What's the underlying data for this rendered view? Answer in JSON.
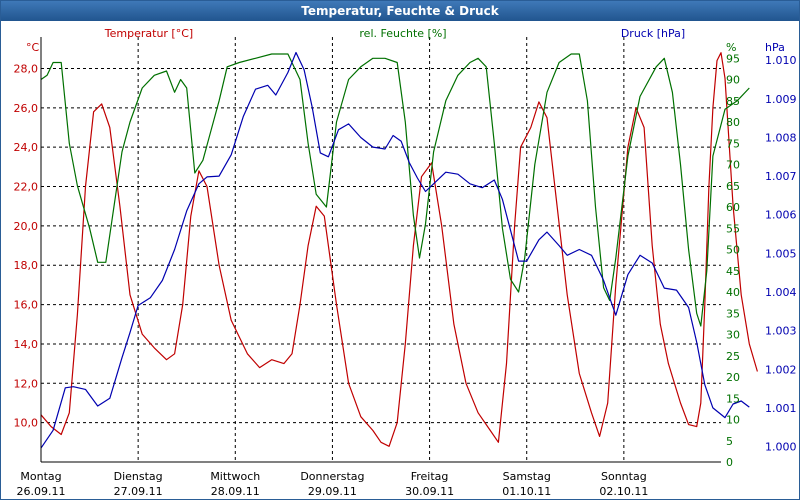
{
  "window": {
    "title": "Temperatur, Feuchte & Druck"
  },
  "colors": {
    "temperature": "#c00000",
    "humidity": "#007000",
    "pressure": "#0000b0",
    "grid": "#000000",
    "frame": "#2a5d96"
  },
  "chart_data": {
    "type": "line",
    "title": "Temperatur, Feuchte & Druck",
    "x_start": "26.09.11 00:00",
    "x_end": "03.10.11 00:00",
    "x_categories": [
      {
        "day": "Montag",
        "date": "26.09.11"
      },
      {
        "day": "Dienstag",
        "date": "27.09.11"
      },
      {
        "day": "Mittwoch",
        "date": "28.09.11"
      },
      {
        "day": "Donnerstag",
        "date": "29.09.11"
      },
      {
        "day": "Freitag",
        "date": "30.09.11"
      },
      {
        "day": "Samstag",
        "date": "01.10.11"
      },
      {
        "day": "Sonntag",
        "date": "02.10.11"
      }
    ],
    "axes": {
      "left": {
        "label": "Temperatur [°C]",
        "unit": "°C",
        "min": 8,
        "max": 29.6,
        "ticks": [
          10.0,
          12.0,
          14.0,
          16.0,
          18.0,
          20.0,
          22.0,
          24.0,
          26.0,
          28.0
        ],
        "tick_labels": [
          "10,0",
          "12,0",
          "14,0",
          "16,0",
          "18,0",
          "20,0",
          "22,0",
          "24,0",
          "26,0",
          "28,0"
        ]
      },
      "middle": {
        "label": "rel. Feuchte [%]",
        "unit": "%",
        "min": 0,
        "max": 100,
        "ticks": [
          0,
          5,
          10,
          15,
          20,
          25,
          30,
          35,
          40,
          45,
          50,
          55,
          60,
          65,
          70,
          75,
          80,
          85,
          90,
          95
        ],
        "tick_labels": [
          "0",
          "5",
          "10",
          "15",
          "20",
          "25",
          "30",
          "35",
          "40",
          "45",
          "50",
          "55",
          "60",
          "65",
          "70",
          "75",
          "80",
          "85",
          "90",
          "95"
        ]
      },
      "right": {
        "label": "Druck [hPa]",
        "unit": "hPa",
        "min": 0.9996,
        "max": 1.0106,
        "ticks": [
          1.0,
          1.001,
          1.002,
          1.003,
          1.004,
          1.005,
          1.006,
          1.007,
          1.008,
          1.009,
          1.01
        ],
        "tick_labels": [
          "1.000",
          "1.001",
          "1.002",
          "1.003",
          "1.004",
          "1.005",
          "1.006",
          "1.007",
          "1.008",
          "1.009",
          "1.010"
        ]
      }
    },
    "grid": true,
    "series": [
      {
        "name": "Temperatur [°C]",
        "axis": "left",
        "color": "#c00000",
        "points": [
          [
            "26.09.11 00:00",
            10.4
          ],
          [
            "26.09.11 02:30",
            9.8
          ],
          [
            "26.09.11 05:00",
            9.4
          ],
          [
            "26.09.11 07:00",
            10.5
          ],
          [
            "26.09.11 09:00",
            15.5
          ],
          [
            "26.09.11 11:00",
            22.0
          ],
          [
            "26.09.11 13:00",
            25.8
          ],
          [
            "26.09.11 15:00",
            26.2
          ],
          [
            "26.09.11 17:00",
            25.0
          ],
          [
            "26.09.11 19:30",
            21.0
          ],
          [
            "26.09.11 22:00",
            16.5
          ],
          [
            "27.09.11 01:00",
            14.5
          ],
          [
            "27.09.11 04:00",
            13.8
          ],
          [
            "27.09.11 07:00",
            13.2
          ],
          [
            "27.09.11 09:00",
            13.5
          ],
          [
            "27.09.11 11:00",
            16.0
          ],
          [
            "27.09.11 13:00",
            20.5
          ],
          [
            "27.09.11 15:00",
            22.8
          ],
          [
            "27.09.11 17:00",
            22.0
          ],
          [
            "27.09.11 20:00",
            18.0
          ],
          [
            "27.09.11 23:00",
            15.2
          ],
          [
            "28.09.11 03:00",
            13.5
          ],
          [
            "28.09.11 06:00",
            12.8
          ],
          [
            "28.09.11 09:00",
            13.2
          ],
          [
            "28.09.11 12:00",
            13.0
          ],
          [
            "28.09.11 14:00",
            13.5
          ],
          [
            "28.09.11 16:00",
            16.0
          ],
          [
            "28.09.11 18:00",
            19.0
          ],
          [
            "28.09.11 20:00",
            21.0
          ],
          [
            "28.09.11 22:00",
            20.5
          ],
          [
            "29.09.11 01:00",
            16.0
          ],
          [
            "29.09.11 04:00",
            12.0
          ],
          [
            "29.09.11 07:00",
            10.3
          ],
          [
            "29.09.11 10:00",
            9.6
          ],
          [
            "29.09.11 12:00",
            9.0
          ],
          [
            "29.09.11 14:00",
            8.8
          ],
          [
            "29.09.11 16:00",
            10.0
          ],
          [
            "29.09.11 18:00",
            14.0
          ],
          [
            "29.09.11 20:00",
            19.0
          ],
          [
            "29.09.11 22:00",
            22.5
          ],
          [
            "30.09.11 00:30",
            23.2
          ],
          [
            "30.09.11 03:00",
            20.0
          ],
          [
            "30.09.11 06:00",
            15.0
          ],
          [
            "30.09.11 09:00",
            12.0
          ],
          [
            "30.09.11 12:00",
            10.5
          ],
          [
            "30.09.11 15:00",
            9.6
          ],
          [
            "30.09.11 17:00",
            9.0
          ],
          [
            "30.09.11 19:00",
            13.0
          ],
          [
            "30.09.11 21:00",
            20.0
          ],
          [
            "30.09.11 22:30",
            24.0
          ],
          [
            "01.10.11 01:00",
            25.0
          ],
          [
            "01.10.11 03:00",
            26.3
          ],
          [
            "01.10.11 05:00",
            25.5
          ],
          [
            "01.10.11 07:30",
            21.0
          ],
          [
            "01.10.11 10:00",
            16.5
          ],
          [
            "01.10.11 13:00",
            12.5
          ],
          [
            "01.10.11 16:00",
            10.5
          ],
          [
            "01.10.11 18:00",
            9.3
          ],
          [
            "01.10.11 20:00",
            11.0
          ],
          [
            "01.10.11 22:00",
            17.0
          ],
          [
            "02.10.11 01:00",
            24.0
          ],
          [
            "02.10.11 03:00",
            26.0
          ],
          [
            "02.10.11 05:00",
            25.0
          ],
          [
            "02.10.11 07:00",
            19.0
          ],
          [
            "02.10.11 09:00",
            15.0
          ],
          [
            "02.10.11 11:00",
            13.0
          ],
          [
            "02.10.11 14:00",
            11.0
          ],
          [
            "02.10.11 16:00",
            9.9
          ],
          [
            "02.10.11 18:00",
            9.8
          ],
          [
            "02.10.11 19:00",
            11.0
          ],
          [
            "02.10.11 20:00",
            16.0
          ],
          [
            "02.10.11 21:00",
            22.0
          ],
          [
            "02.10.11 22:00",
            26.0
          ],
          [
            "02.10.11 23:00",
            28.4
          ],
          [
            "03.10.11 00:00",
            28.8
          ],
          [
            "03.10.11 01:00",
            27.5
          ],
          [
            "03.10.11 03:00",
            21.0
          ],
          [
            "03.10.11 05:00",
            16.5
          ],
          [
            "03.10.11 07:00",
            14.0
          ],
          [
            "03.10.11 09:00",
            12.6
          ]
        ]
      },
      {
        "name": "rel. Feuchte [%]",
        "axis": "middle",
        "color": "#007000",
        "points": [
          [
            "26.09.11 00:00",
            90
          ],
          [
            "26.09.11 01:30",
            91
          ],
          [
            "26.09.11 03:00",
            94
          ],
          [
            "26.09.11 05:00",
            94
          ],
          [
            "26.09.11 07:00",
            75
          ],
          [
            "26.09.11 09:00",
            65
          ],
          [
            "26.09.11 12:00",
            55
          ],
          [
            "26.09.11 14:00",
            47
          ],
          [
            "26.09.11 16:00",
            47
          ],
          [
            "26.09.11 18:00",
            60
          ],
          [
            "26.09.11 20:00",
            73
          ],
          [
            "26.09.11 22:00",
            80
          ],
          [
            "27.09.11 01:00",
            88
          ],
          [
            "27.09.11 04:00",
            91
          ],
          [
            "27.09.11 07:00",
            92
          ],
          [
            "27.09.11 09:00",
            87
          ],
          [
            "27.09.11 10:30",
            90
          ],
          [
            "27.09.11 12:00",
            88
          ],
          [
            "27.09.11 14:00",
            68
          ],
          [
            "27.09.11 16:00",
            71
          ],
          [
            "27.09.11 18:00",
            78
          ],
          [
            "27.09.11 20:00",
            85
          ],
          [
            "27.09.11 22:00",
            93
          ],
          [
            "28.09.11 01:00",
            94
          ],
          [
            "28.09.11 05:00",
            95
          ],
          [
            "28.09.11 09:00",
            96
          ],
          [
            "28.09.11 13:00",
            96
          ],
          [
            "28.09.11 16:00",
            90
          ],
          [
            "28.09.11 18:00",
            75
          ],
          [
            "28.09.11 20:00",
            63
          ],
          [
            "28.09.11 22:30",
            60
          ],
          [
            "29.09.11 01:00",
            80
          ],
          [
            "29.09.11 04:00",
            90
          ],
          [
            "29.09.11 07:00",
            93
          ],
          [
            "29.09.11 10:00",
            95
          ],
          [
            "29.09.11 13:00",
            95
          ],
          [
            "29.09.11 16:00",
            94
          ],
          [
            "29.09.11 18:00",
            80
          ],
          [
            "29.09.11 20:00",
            58
          ],
          [
            "29.09.11 21:30",
            48
          ],
          [
            "29.09.11 23:00",
            56
          ],
          [
            "30.09.11 01:00",
            73
          ],
          [
            "30.09.11 04:00",
            85
          ],
          [
            "30.09.11 07:00",
            91
          ],
          [
            "30.09.11 10:00",
            94
          ],
          [
            "30.09.11 12:00",
            95
          ],
          [
            "30.09.11 14:00",
            93
          ],
          [
            "30.09.11 16:00",
            75
          ],
          [
            "30.09.11 18:00",
            55
          ],
          [
            "30.09.11 20:00",
            43
          ],
          [
            "30.09.11 22:00",
            40
          ],
          [
            "30.09.11 23:30",
            48
          ],
          [
            "01.10.11 02:00",
            70
          ],
          [
            "01.10.11 05:00",
            87
          ],
          [
            "01.10.11 08:00",
            94
          ],
          [
            "01.10.11 11:00",
            96
          ],
          [
            "01.10.11 13:00",
            96
          ],
          [
            "01.10.11 15:00",
            85
          ],
          [
            "01.10.11 17:00",
            60
          ],
          [
            "01.10.11 19:00",
            41
          ],
          [
            "01.10.11 20:30",
            38
          ],
          [
            "01.10.11 22:00",
            48
          ],
          [
            "02.10.11 01:00",
            72
          ],
          [
            "02.10.11 04:00",
            86
          ],
          [
            "02.10.11 08:00",
            93
          ],
          [
            "02.10.11 10:00",
            95
          ],
          [
            "02.10.11 12:00",
            87
          ],
          [
            "02.10.11 14:00",
            70
          ],
          [
            "02.10.11 16:00",
            50
          ],
          [
            "02.10.11 18:00",
            35
          ],
          [
            "02.10.11 19:00",
            32
          ],
          [
            "02.10.11 20:30",
            45
          ],
          [
            "02.10.11 22:00",
            72
          ],
          [
            "03.10.11 01:00",
            83
          ],
          [
            "03.10.11 04:00",
            85
          ],
          [
            "03.10.11 07:00",
            88
          ]
        ]
      },
      {
        "name": "Druck [hPa]",
        "axis": "right",
        "color": "#0000b0",
        "points": [
          [
            "26.09.11 00:00",
            0.99996
          ],
          [
            "26.09.11 03:00",
            1.00042
          ],
          [
            "26.09.11 06:00",
            1.00152
          ],
          [
            "26.09.11 08:00",
            1.00155
          ],
          [
            "26.09.11 11:00",
            1.00148
          ],
          [
            "26.09.11 14:00",
            1.00105
          ],
          [
            "26.09.11 17:00",
            1.00125
          ],
          [
            "26.09.11 20:00",
            1.0023
          ],
          [
            "26.09.11 22:00",
            1.00295
          ],
          [
            "27.09.11 00:00",
            1.00365
          ],
          [
            "27.09.11 03:00",
            1.00385
          ],
          [
            "27.09.11 06:00",
            1.0043
          ],
          [
            "27.09.11 09:00",
            1.0051
          ],
          [
            "27.09.11 12:00",
            1.0061
          ],
          [
            "27.09.11 15:00",
            1.0068
          ],
          [
            "27.09.11 17:00",
            1.00698
          ],
          [
            "27.09.11 20:00",
            1.007
          ],
          [
            "27.09.11 23:00",
            1.00755
          ],
          [
            "28.09.11 02:00",
            1.00855
          ],
          [
            "28.09.11 05:00",
            1.00925
          ],
          [
            "28.09.11 08:00",
            1.00935
          ],
          [
            "28.09.11 10:00",
            1.0091
          ],
          [
            "28.09.11 13:00",
            1.00968
          ],
          [
            "28.09.11 15:00",
            1.0102
          ],
          [
            "28.09.11 17:00",
            1.00975
          ],
          [
            "28.09.11 19:00",
            1.00878
          ],
          [
            "28.09.11 21:00",
            1.0076
          ],
          [
            "28.09.11 23:00",
            1.0075
          ],
          [
            "29.09.11 01:30",
            1.0082
          ],
          [
            "29.09.11 04:00",
            1.00835
          ],
          [
            "29.09.11 07:00",
            1.008
          ],
          [
            "29.09.11 10:00",
            1.00775
          ],
          [
            "29.09.11 13:00",
            1.0077
          ],
          [
            "29.09.11 15:00",
            1.00805
          ],
          [
            "29.09.11 17:00",
            1.0079
          ],
          [
            "29.09.11 19:00",
            1.00735
          ],
          [
            "29.09.11 21:00",
            1.00695
          ],
          [
            "29.09.11 23:00",
            1.0066
          ],
          [
            "30.09.11 01:00",
            1.0068
          ],
          [
            "30.09.11 04:00",
            1.0071
          ],
          [
            "30.09.11 07:00",
            1.00705
          ],
          [
            "30.09.11 10:00",
            1.0068
          ],
          [
            "30.09.11 13:00",
            1.0067
          ],
          [
            "30.09.11 16:00",
            1.0069
          ],
          [
            "30.09.11 18:00",
            1.0064
          ],
          [
            "30.09.11 20:00",
            1.0056
          ],
          [
            "30.09.11 22:00",
            1.0048
          ],
          [
            "01.10.11 00:00",
            1.0048
          ],
          [
            "01.10.11 03:00",
            1.00535
          ],
          [
            "01.10.11 05:00",
            1.00555
          ],
          [
            "01.10.11 08:00",
            1.0052
          ],
          [
            "01.10.11 10:00",
            1.00495
          ],
          [
            "01.10.11 13:00",
            1.0051
          ],
          [
            "01.10.11 16:00",
            1.00495
          ],
          [
            "01.10.11 19:00",
            1.0043
          ],
          [
            "01.10.11 22:00",
            1.0034
          ],
          [
            "02.10.11 01:00",
            1.00445
          ],
          [
            "02.10.11 04:00",
            1.00495
          ],
          [
            "02.10.11 07:00",
            1.00475
          ],
          [
            "02.10.11 10:00",
            1.0041
          ],
          [
            "02.10.11 13:00",
            1.00405
          ],
          [
            "02.10.11 16:00",
            1.0036
          ],
          [
            "02.10.11 18:00",
            1.0027
          ],
          [
            "02.10.11 20:00",
            1.0016
          ],
          [
            "02.10.11 22:00",
            1.001
          ],
          [
            "03.10.11 01:00",
            1.00075
          ],
          [
            "03.10.11 03:00",
            1.0011
          ],
          [
            "03.10.11 05:00",
            1.00118
          ],
          [
            "03.10.11 07:00",
            1.00102
          ]
        ]
      }
    ]
  }
}
